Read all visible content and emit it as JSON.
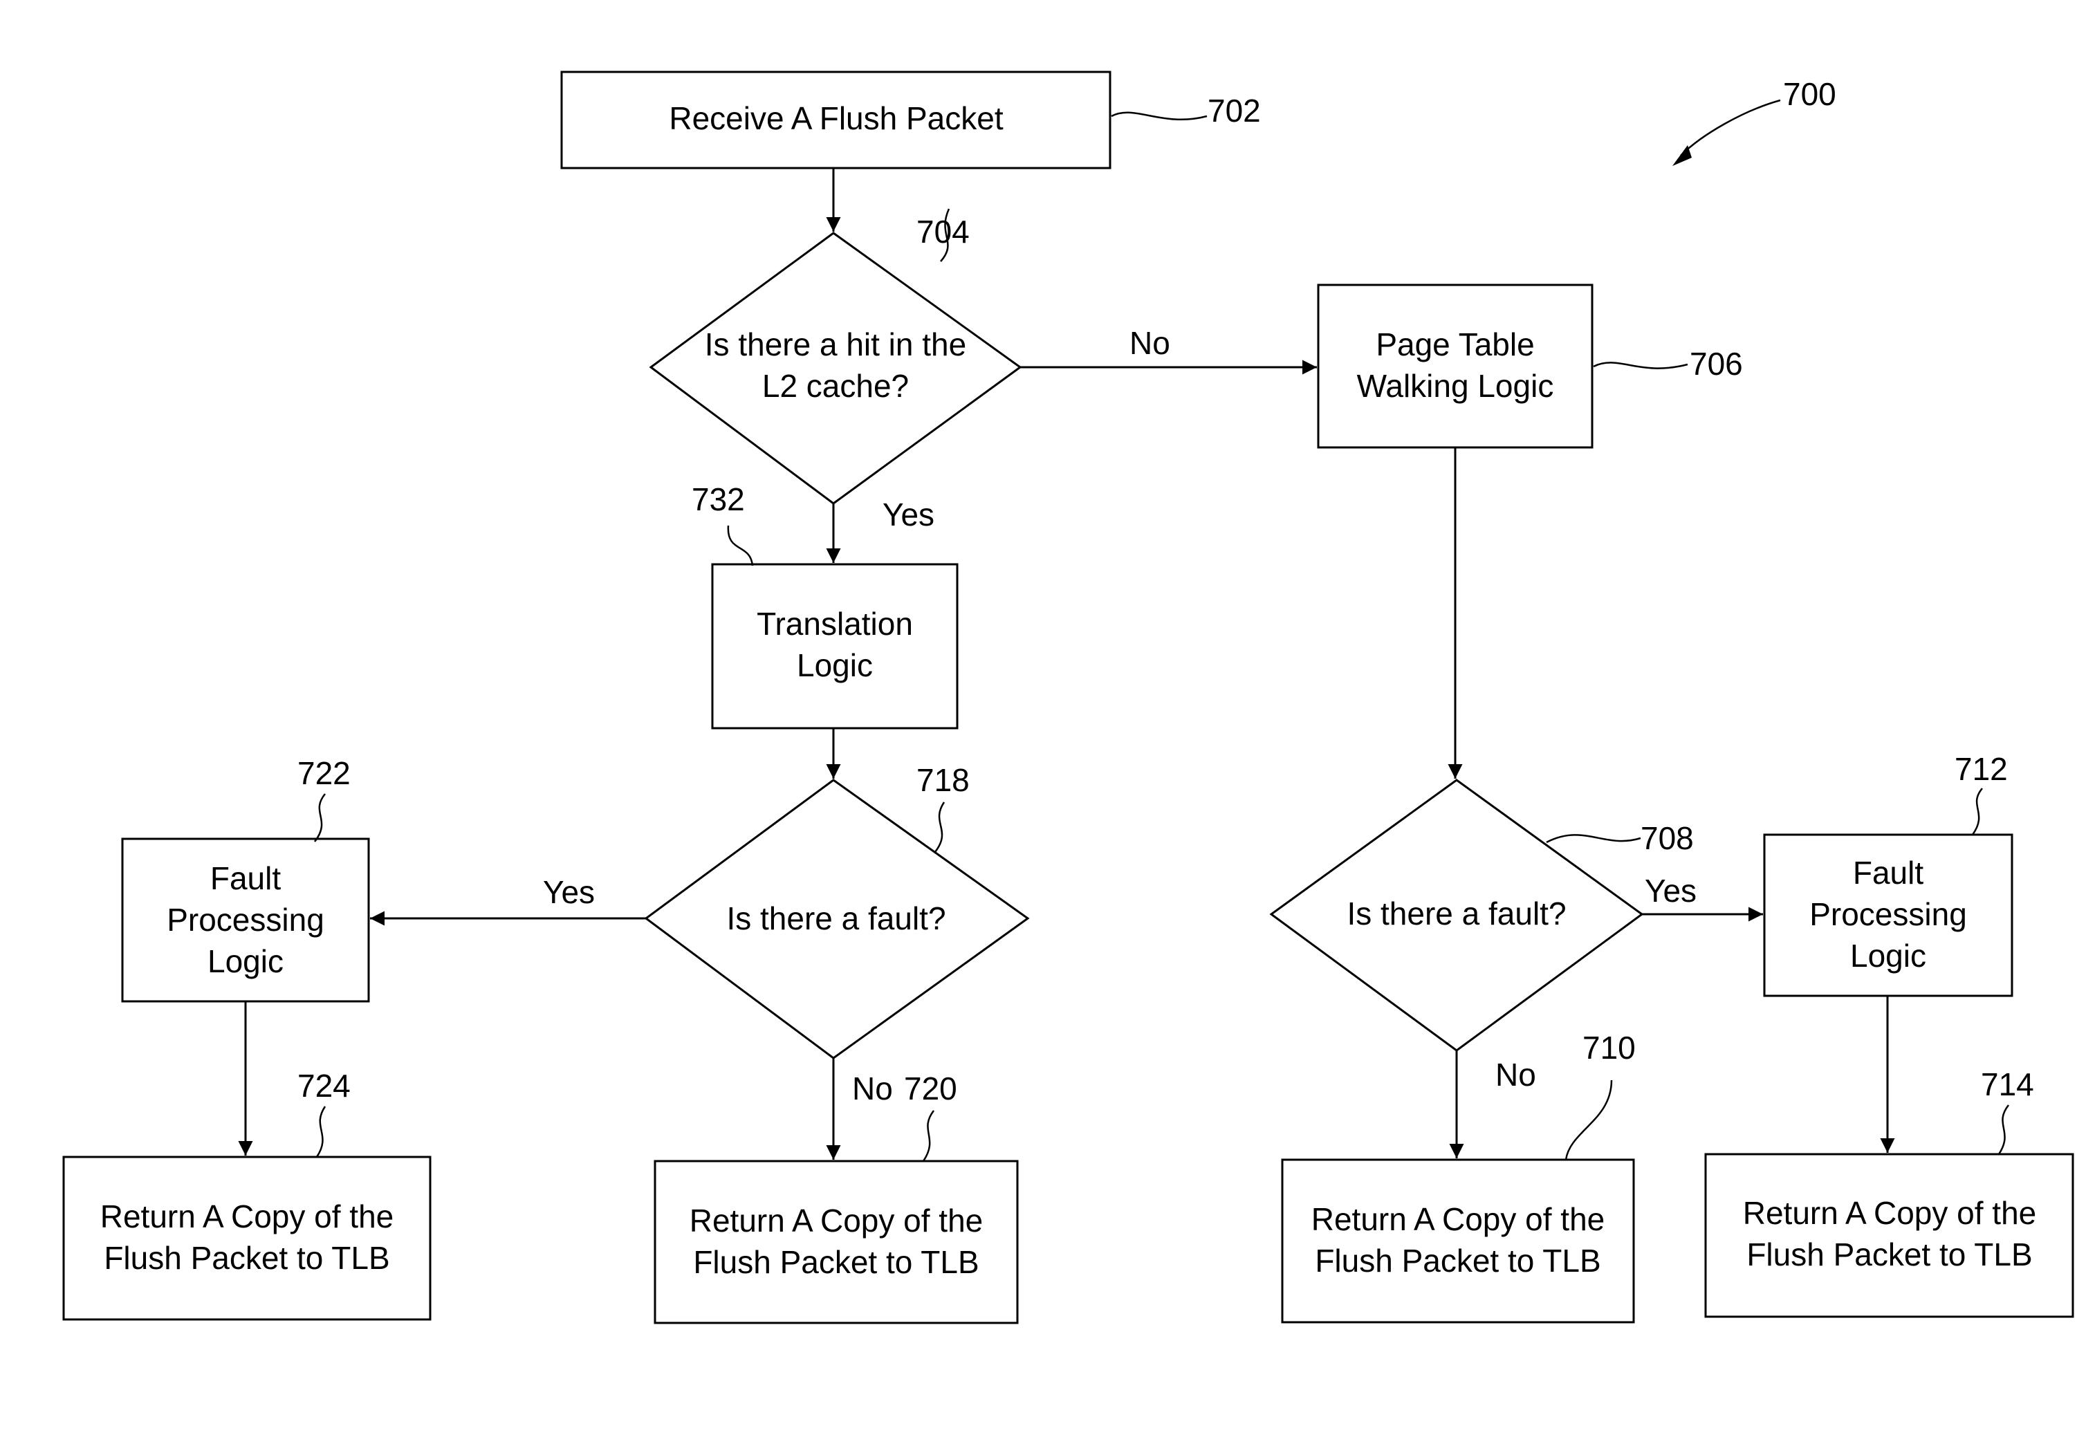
{
  "figure": {
    "ref": "700"
  },
  "nodes": {
    "n702": {
      "ref": "702",
      "type": "process",
      "lines": [
        "Receive A Flush Packet"
      ]
    },
    "n704": {
      "ref": "704",
      "type": "decision",
      "lines": [
        "Is there a hit in the",
        "L2 cache?"
      ]
    },
    "n706": {
      "ref": "706",
      "type": "process",
      "lines": [
        "Page Table",
        "Walking Logic"
      ]
    },
    "n732": {
      "ref": "732",
      "type": "process",
      "lines": [
        "Translation",
        "Logic"
      ]
    },
    "n718": {
      "ref": "718",
      "type": "decision",
      "lines": [
        "Is there a fault?"
      ]
    },
    "n722": {
      "ref": "722",
      "type": "process",
      "lines": [
        "Fault",
        "Processing",
        "Logic"
      ]
    },
    "n724": {
      "ref": "724",
      "type": "process",
      "lines": [
        "Return A Copy of the",
        "Flush Packet to TLB"
      ]
    },
    "n720": {
      "ref": "720",
      "type": "process",
      "lines": [
        "Return A Copy of the",
        "Flush Packet to TLB"
      ]
    },
    "n708": {
      "ref": "708",
      "type": "decision",
      "lines": [
        "Is there a fault?"
      ]
    },
    "n712": {
      "ref": "712",
      "type": "process",
      "lines": [
        "Fault",
        "Processing",
        "Logic"
      ]
    },
    "n710": {
      "ref": "710",
      "type": "process",
      "lines": [
        "Return A Copy of the",
        "Flush Packet to TLB"
      ]
    },
    "n714": {
      "ref": "714",
      "type": "process",
      "lines": [
        "Return A Copy of the",
        "Flush Packet to TLB"
      ]
    }
  },
  "edges": [
    {
      "from": "702",
      "to": "704",
      "label": ""
    },
    {
      "from": "704",
      "to": "706",
      "label": "No"
    },
    {
      "from": "704",
      "to": "732",
      "label": "Yes"
    },
    {
      "from": "732",
      "to": "718",
      "label": ""
    },
    {
      "from": "718",
      "to": "722",
      "label": "Yes"
    },
    {
      "from": "718",
      "to": "720",
      "label": "No"
    },
    {
      "from": "722",
      "to": "724",
      "label": ""
    },
    {
      "from": "706",
      "to": "708",
      "label": ""
    },
    {
      "from": "708",
      "to": "712",
      "label": "Yes"
    },
    {
      "from": "708",
      "to": "710",
      "label": "No"
    },
    {
      "from": "712",
      "to": "714",
      "label": ""
    }
  ]
}
